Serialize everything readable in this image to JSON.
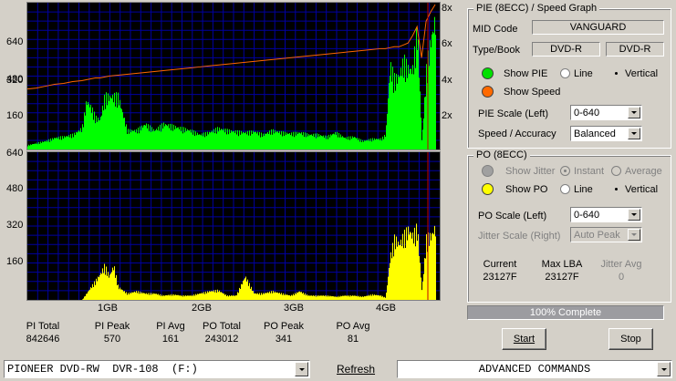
{
  "pie_axis": {
    "left_ticks": [
      "640",
      "480",
      "320",
      "160"
    ],
    "right_ticks": [
      "8x",
      "6x",
      "4x",
      "2x"
    ]
  },
  "po_axis": {
    "left_ticks": [
      "640",
      "480",
      "320",
      "160"
    ],
    "x_ticks": [
      "1GB",
      "2GB",
      "3GB",
      "4GB"
    ]
  },
  "colors": {
    "pie": "#00ff00",
    "speed": "#ff6600",
    "po": "#ffff00",
    "grid": "#0000a0",
    "plot_bg": "#000000",
    "marker": "#c00000"
  },
  "chart_data": [
    {
      "type": "area",
      "title": "PIE (8ECC)",
      "xlabel": "",
      "ylabel": "",
      "xlim": [
        0,
        4.55
      ],
      "ylim": [
        0,
        640
      ],
      "x": [
        0,
        0.1,
        0.2,
        0.3,
        0.4,
        0.5,
        0.6,
        0.65,
        0.7,
        0.75,
        0.8,
        0.85,
        0.9,
        1.0,
        1.1,
        1.2,
        1.3,
        1.4,
        1.5,
        1.6,
        1.7,
        1.8,
        1.9,
        2.0,
        2.1,
        2.2,
        2.3,
        2.4,
        2.5,
        2.6,
        2.7,
        2.8,
        2.9,
        3.0,
        3.1,
        3.2,
        3.3,
        3.4,
        3.5,
        3.6,
        3.7,
        3.8,
        3.9,
        3.95,
        4.0,
        4.05,
        4.1,
        4.15,
        4.2,
        4.25,
        4.3,
        4.35,
        4.4,
        4.45,
        4.5
      ],
      "series": [
        {
          "values": [
            20,
            30,
            40,
            55,
            60,
            70,
            100,
            230,
            200,
            150,
            140,
            250,
            250,
            250,
            90,
            90,
            120,
            90,
            120,
            110,
            100,
            90,
            70,
            80,
            100,
            90,
            85,
            80,
            85,
            70,
            90,
            80,
            75,
            80,
            70,
            70,
            60,
            80,
            55,
            60,
            40,
            50,
            50,
            70,
            400,
            330,
            350,
            420,
            380,
            380,
            580,
            30,
            380,
            520,
            620
          ]
        },
        {
          "values": [
            3.3,
            3.35,
            3.45,
            3.55,
            3.6,
            3.7,
            3.75,
            3.8,
            3.85,
            3.9,
            3.9,
            3.95,
            4.0,
            4.05,
            4.1,
            4.15,
            4.2,
            4.25,
            4.3,
            4.35,
            4.4,
            4.45,
            4.5,
            4.55,
            4.6,
            4.65,
            4.7,
            4.75,
            4.8,
            4.85,
            4.9,
            4.95,
            5.0,
            5.05,
            5.1,
            5.15,
            5.2,
            5.25,
            5.3,
            5.35,
            5.4,
            5.45,
            5.5,
            5.5,
            5.55,
            5.6,
            5.6,
            5.7,
            5.8,
            6.2,
            6.7,
            5.0,
            7.0,
            7.5,
            7.9
          ]
        }
      ]
    },
    {
      "type": "area",
      "title": "PO (8ECC)",
      "xlabel": "",
      "ylabel": "",
      "xlim": [
        0,
        4.55
      ],
      "ylim": [
        0,
        640
      ],
      "x": [
        0,
        0.1,
        0.2,
        0.3,
        0.4,
        0.5,
        0.6,
        0.7,
        0.75,
        0.8,
        0.85,
        0.9,
        0.95,
        1.0,
        1.1,
        1.2,
        1.3,
        1.4,
        1.5,
        1.6,
        1.7,
        1.8,
        1.9,
        2.0,
        2.1,
        2.2,
        2.3,
        2.4,
        2.5,
        2.6,
        2.7,
        2.8,
        2.9,
        3.0,
        3.1,
        3.2,
        3.3,
        3.4,
        3.5,
        3.6,
        3.7,
        3.8,
        3.9,
        3.95,
        4.0,
        4.05,
        4.1,
        4.15,
        4.2,
        4.25,
        4.3,
        4.35,
        4.4,
        4.45,
        4.5
      ],
      "series": [
        {
          "values": [
            0,
            0,
            0,
            0,
            0,
            0,
            0,
            60,
            90,
            120,
            160,
            110,
            160,
            60,
            30,
            40,
            30,
            30,
            20,
            25,
            20,
            20,
            30,
            40,
            45,
            20,
            20,
            110,
            30,
            30,
            40,
            30,
            20,
            40,
            20,
            20,
            20,
            15,
            20,
            20,
            15,
            25,
            20,
            10,
            200,
            290,
            260,
            300,
            330,
            300,
            340,
            40,
            290,
            300,
            341
          ]
        }
      ]
    }
  ],
  "pie_panel": {
    "title": "PIE (8ECC) / Speed Graph",
    "mid_label": "MID Code",
    "mid_value": "VANGUARD",
    "type_label": "Type/Book",
    "type_value": "DVD-R",
    "book_value": "DVD-R",
    "show_pie": "Show PIE",
    "line": "Line",
    "vertical": "Vertical",
    "show_speed": "Show Speed",
    "scale_label": "PIE Scale (Left)",
    "scale_value": "0-640",
    "accuracy_label": "Speed / Accuracy",
    "accuracy_value": "Balanced"
  },
  "po_panel": {
    "title": "PO (8ECC)",
    "show_jitter": "Show Jitter",
    "instant": "Instant",
    "average": "Average",
    "show_po": "Show PO",
    "line": "Line",
    "vertical": "Vertical",
    "scale_label": "PO Scale (Left)",
    "scale_value": "0-640",
    "jitter_scale_label": "Jitter Scale (Right)",
    "jitter_scale_value": "Auto Peak",
    "current_label": "Current",
    "current_value": "23127F",
    "maxlba_label": "Max LBA",
    "maxlba_value": "23127F",
    "jitter_avg_label": "Jitter Avg",
    "jitter_avg_value": "0"
  },
  "progress": {
    "text": "100% Complete",
    "value": 1.0
  },
  "stats": [
    {
      "label": "PI Total",
      "value": "842646"
    },
    {
      "label": "PI Peak",
      "value": "570"
    },
    {
      "label": "PI Avg",
      "value": "161"
    },
    {
      "label": "PO Total",
      "value": "243012"
    },
    {
      "label": "PO Peak",
      "value": "341"
    },
    {
      "label": "PO Avg",
      "value": "81"
    }
  ],
  "buttons": {
    "start": "Start",
    "stop": "Stop",
    "refresh": "Refresh"
  },
  "drive": "PIONEER DVD-RW  DVR-108  (F:)",
  "commands": "ADVANCED COMMANDS"
}
